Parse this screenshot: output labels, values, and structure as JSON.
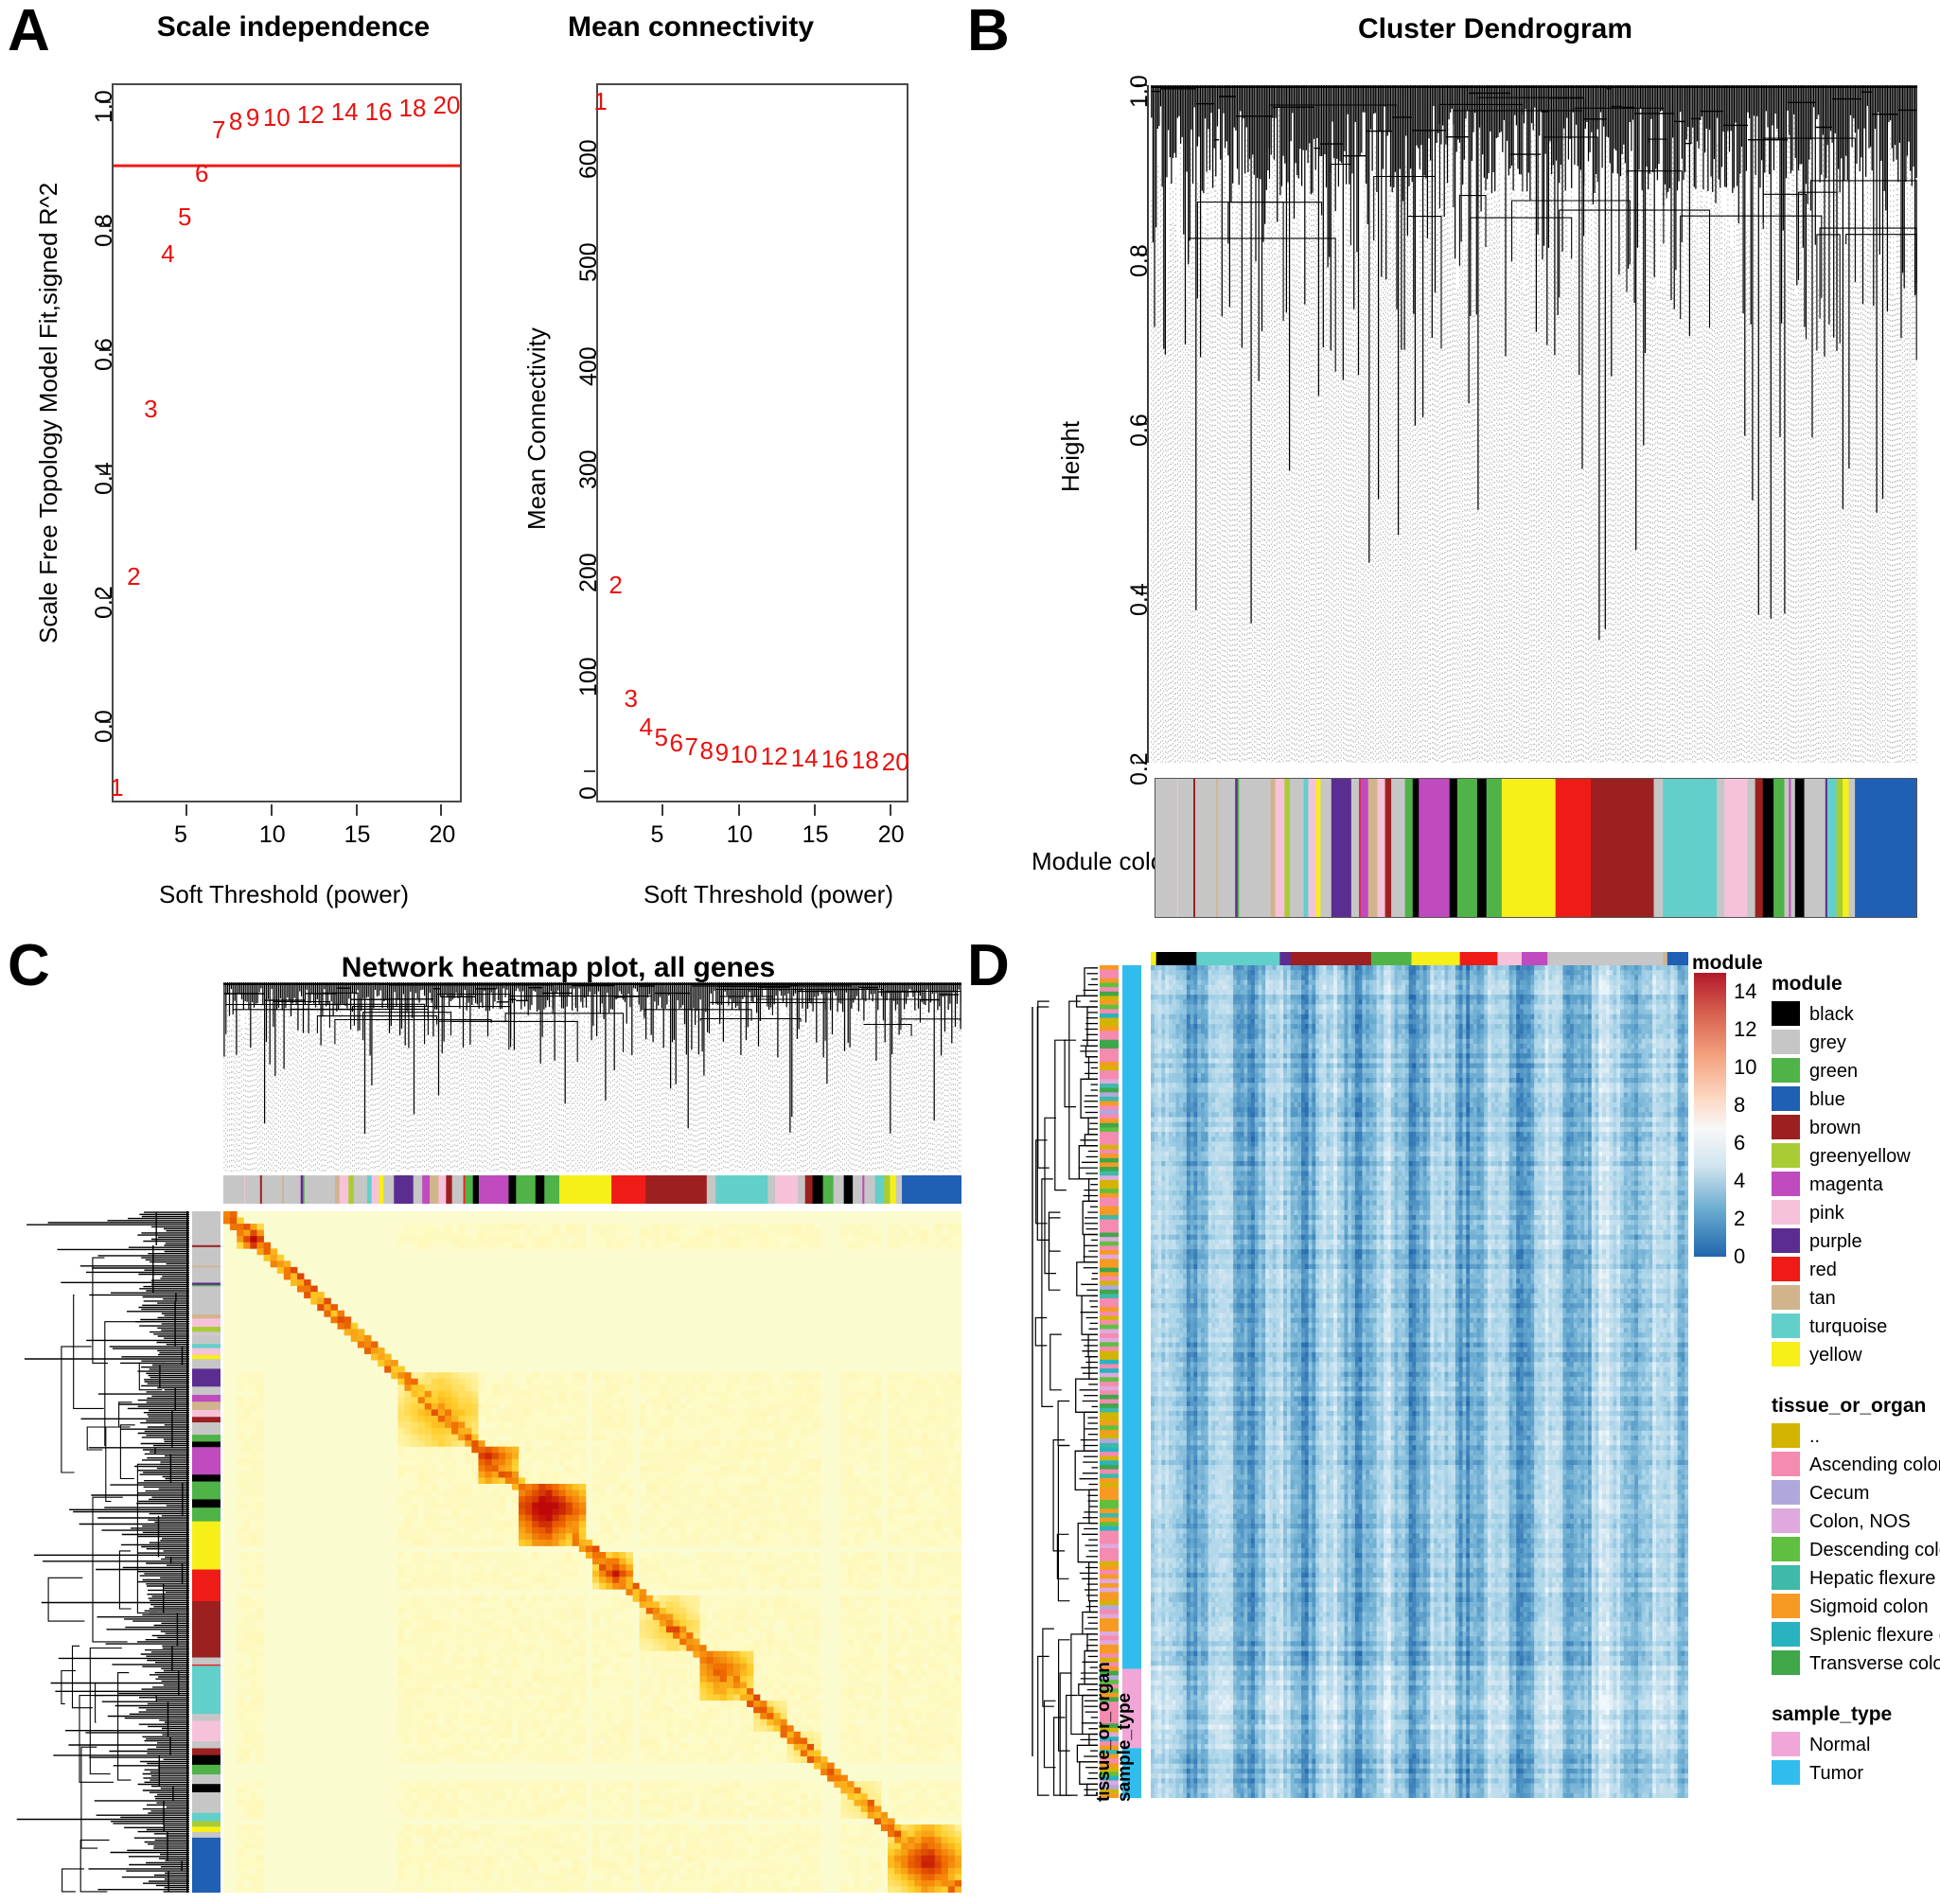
{
  "figure": {
    "panels": [
      "A",
      "B",
      "C",
      "D"
    ]
  },
  "panelA": {
    "letter": "A",
    "left": {
      "title": "Scale independence",
      "ylabel": "Scale Free Topology Model Fit,signed R^2",
      "xlabel": "Soft Threshold (power)",
      "yticks": [
        "1.0",
        "0.8",
        "0.6",
        "0.4",
        "0.2",
        "0.0"
      ],
      "ytickvals": [
        1.0,
        0.8,
        0.6,
        0.4,
        0.2,
        0.0
      ],
      "xticks": [
        "5",
        "10",
        "15",
        "20"
      ],
      "xtickvals": [
        5,
        10,
        15,
        20
      ],
      "threshold_line": 0.9,
      "threshold_color": "#ef1b16",
      "label_color": "#e8110e"
    },
    "right": {
      "title": "Mean connectivity",
      "ylabel": "Mean Connectivity",
      "xlabel": "Soft Threshold (power)",
      "yticks": [
        "600",
        "500",
        "400",
        "300",
        "200",
        "100",
        "0"
      ],
      "ytickvals": [
        600,
        500,
        400,
        300,
        200,
        100,
        0
      ],
      "xticks": [
        "5",
        "10",
        "15",
        "20"
      ],
      "xtickvals": [
        5,
        10,
        15,
        20
      ]
    }
  },
  "panelB": {
    "letter": "B",
    "title": "Cluster Dendrogram",
    "ylabel": "Height",
    "yticks": [
      "1.0",
      "0.8",
      "0.6",
      "0.4",
      "0.2"
    ],
    "ytickvals": [
      1.0,
      0.8,
      0.6,
      0.4,
      0.2
    ],
    "module_colors_label": "Module colors"
  },
  "panelC": {
    "letter": "C",
    "title": "Network heatmap plot, all genes"
  },
  "panelD": {
    "letter": "D",
    "colorbar": {
      "title": "module",
      "ticks": [
        "14",
        "12",
        "10",
        "8",
        "6",
        "4",
        "2",
        "0"
      ],
      "tickvals": [
        14,
        12,
        10,
        8,
        6,
        4,
        2,
        0
      ],
      "min": 0,
      "max": 15
    },
    "row_labels": [
      "sample_type",
      "tissue_or_organ"
    ],
    "legends": [
      {
        "title": "module",
        "items": [
          {
            "label": "black",
            "color": "#000000"
          },
          {
            "label": "grey",
            "color": "#c6c6c6"
          },
          {
            "label": "green",
            "color": "#4fb348"
          },
          {
            "label": "blue",
            "color": "#1f5fb4"
          },
          {
            "label": "brown",
            "color": "#9c2020"
          },
          {
            "label": "greenyellow",
            "color": "#a9cc34"
          },
          {
            "label": "magenta",
            "color": "#bf4bbf"
          },
          {
            "label": "pink",
            "color": "#f6c2da"
          },
          {
            "label": "purple",
            "color": "#5c2d91"
          },
          {
            "label": "red",
            "color": "#ef1b16"
          },
          {
            "label": "tan",
            "color": "#d2b48c"
          },
          {
            "label": "turquoise",
            "color": "#62cfca"
          },
          {
            "label": "yellow",
            "color": "#f7ef18"
          }
        ]
      },
      {
        "title": "tissue_or_organ",
        "items": [
          {
            "label": "..",
            "color": "#d4b402"
          },
          {
            "label": "Ascending colon",
            "color": "#f58bb0"
          },
          {
            "label": "Cecum",
            "color": "#b0a8dd"
          },
          {
            "label": "Colon, NOS",
            "color": "#dfa9dd"
          },
          {
            "label": "Descending colon",
            "color": "#5fc03f"
          },
          {
            "label": "Hepatic flexure of colon",
            "color": "#3fb9a8"
          },
          {
            "label": "Sigmoid colon",
            "color": "#f79a24"
          },
          {
            "label": "Splenic flexure of colon",
            "color": "#29b3c0"
          },
          {
            "label": "Transverse colon",
            "color": "#3fa64a"
          }
        ]
      },
      {
        "title": "sample_type",
        "items": [
          {
            "label": "Normal",
            "color": "#f0a6d6"
          },
          {
            "label": "Tumor",
            "color": "#30bdee"
          }
        ]
      }
    ]
  },
  "chart_data": [
    {
      "id": "scale-independence",
      "type": "scatter",
      "title": "Scale independence",
      "xlabel": "Soft Threshold (power)",
      "ylabel": "Scale Free Topology Model Fit,signed R^2",
      "xlim": [
        0.6,
        21.2
      ],
      "ylim": [
        -0.13,
        1.03
      ],
      "grid": false,
      "hline": {
        "y": 0.9,
        "color": "#ef1b16"
      },
      "point_labels": [
        "1",
        "2",
        "3",
        "4",
        "5",
        "6",
        "7",
        "8",
        "9",
        "10",
        "12",
        "14",
        "16",
        "18",
        "20"
      ],
      "x": [
        1,
        2,
        3,
        4,
        5,
        6,
        7,
        8,
        9,
        10,
        12,
        14,
        16,
        18,
        20
      ],
      "y": [
        -0.11,
        0.23,
        0.5,
        0.75,
        0.81,
        0.88,
        0.95,
        0.965,
        0.97,
        0.97,
        0.975,
        0.98,
        0.98,
        0.985,
        0.99
      ]
    },
    {
      "id": "mean-connectivity",
      "type": "scatter",
      "title": "Mean connectivity",
      "xlabel": "Soft Threshold (power)",
      "ylabel": "Mean Connectivity",
      "xlim": [
        0.6,
        21.2
      ],
      "ylim": [
        -30,
        665
      ],
      "grid": false,
      "point_labels": [
        "1",
        "2",
        "3",
        "4",
        "5",
        "6",
        "7",
        "8",
        "9",
        "10",
        "12",
        "14",
        "16",
        "18",
        "20"
      ],
      "x": [
        1,
        2,
        3,
        4,
        5,
        6,
        7,
        8,
        9,
        10,
        12,
        14,
        16,
        18,
        20
      ],
      "y": [
        645,
        178,
        68,
        40,
        30,
        25,
        21,
        18,
        16,
        14,
        12,
        10,
        9,
        8,
        7
      ]
    },
    {
      "id": "cluster-dendrogram",
      "type": "dendrogram",
      "title": "Cluster Dendrogram",
      "ylabel": "Height",
      "ylim": [
        0.2,
        1.0
      ],
      "grid": false,
      "annotation_track": "Module colors"
    },
    {
      "id": "network-heatmap",
      "type": "heatmap",
      "title": "Network heatmap plot, all genes",
      "colormap": [
        "#fbfbd0",
        "#ffe680",
        "#ffb300",
        "#f25c00",
        "#cc0000"
      ],
      "grid": false
    },
    {
      "id": "expression-heatmap",
      "type": "heatmap",
      "colorbar_title": "module",
      "colorbar_ticks": [
        0,
        2,
        4,
        6,
        8,
        10,
        12,
        14
      ],
      "colormap": [
        "#2166ac",
        "#92c5de",
        "#f7f7f7",
        "#fddbc7",
        "#d6604d",
        "#b2182b"
      ],
      "grid": false
    }
  ]
}
